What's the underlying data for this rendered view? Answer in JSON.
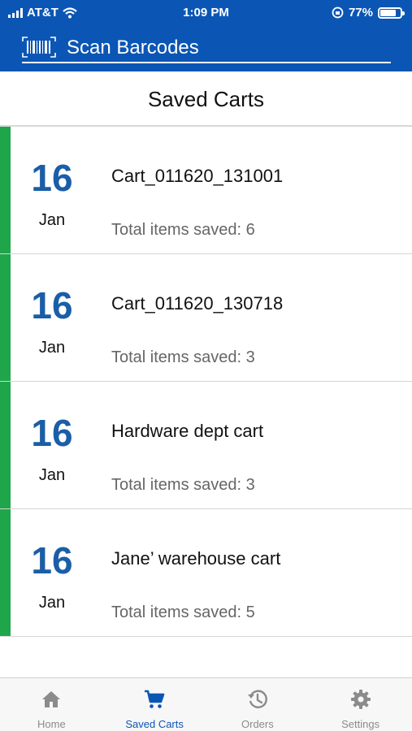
{
  "status_bar": {
    "carrier": "AT&T",
    "time": "1:09 PM",
    "battery": "77%",
    "signal_bars": 4
  },
  "app_bar": {
    "icon": "barcode-icon",
    "title": "Scan Barcodes"
  },
  "page_title": "Saved Carts",
  "carts": [
    {
      "day": "16",
      "month": "Jan",
      "name": "Cart_011620_131001",
      "items_text": "Total items saved: 6"
    },
    {
      "day": "16",
      "month": "Jan",
      "name": "Cart_011620_130718",
      "items_text": "Total items saved: 3"
    },
    {
      "day": "16",
      "month": "Jan",
      "name": "Hardware dept cart",
      "items_text": "Total items saved: 3"
    },
    {
      "day": "16",
      "month": "Jan",
      "name": "Jane’ warehouse cart",
      "items_text": "Total items saved: 5"
    }
  ],
  "tabs": [
    {
      "label": "Home",
      "icon": "home-icon",
      "active": false
    },
    {
      "label": "Saved Carts",
      "icon": "cart-icon",
      "active": true
    },
    {
      "label": "Orders",
      "icon": "history-icon",
      "active": false
    },
    {
      "label": "Settings",
      "icon": "gear-icon",
      "active": false
    }
  ],
  "colors": {
    "header_bg": "#0b56b5",
    "accent_green": "#1fa64b",
    "date_blue": "#1b5ea7",
    "tab_inactive": "#8b8b8b"
  }
}
